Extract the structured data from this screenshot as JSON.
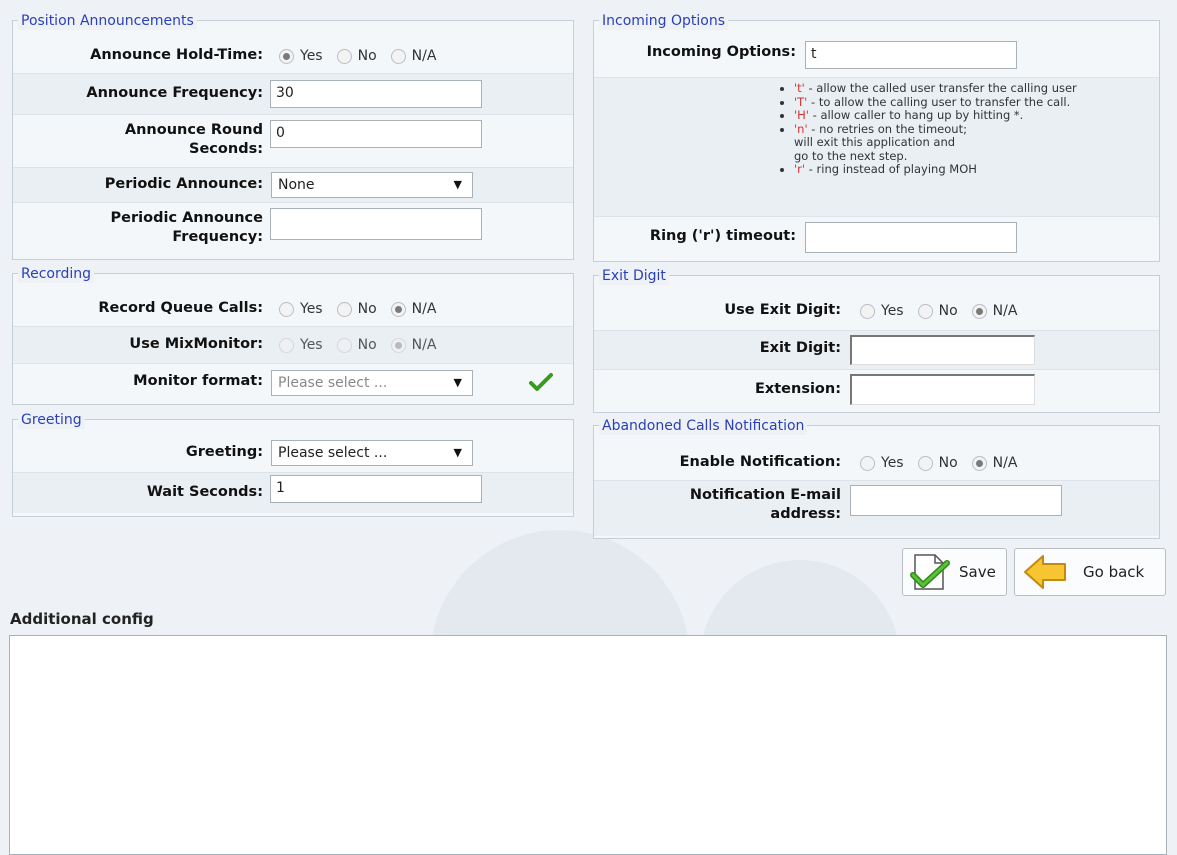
{
  "position_announcements": {
    "title": "Position Announcements",
    "announce_hold_time": {
      "label": "Announce Hold-Time:",
      "options": [
        "Yes",
        "No",
        "N/A"
      ],
      "selected": "Yes"
    },
    "announce_frequency": {
      "label": "Announce Frequency:",
      "value": "30"
    },
    "announce_round_seconds": {
      "label_line1": "Announce Round",
      "label_line2": "Seconds:",
      "value": "0"
    },
    "periodic_announce": {
      "label": "Periodic Announce:",
      "value": "None"
    },
    "periodic_announce_frequency": {
      "label_line1": "Periodic Announce",
      "label_line2": "Frequency:",
      "value": ""
    }
  },
  "recording": {
    "title": "Recording",
    "record_queue_calls": {
      "label": "Record Queue Calls:",
      "options": [
        "Yes",
        "No",
        "N/A"
      ],
      "selected": "N/A"
    },
    "use_mixmonitor": {
      "label": "Use MixMonitor:",
      "options": [
        "Yes",
        "No",
        "N/A"
      ],
      "selected": "N/A"
    },
    "monitor_format": {
      "label": "Monitor format:",
      "value": "Please select ..."
    }
  },
  "greeting": {
    "title": "Greeting",
    "greeting": {
      "label": "Greeting:",
      "value": "Please select ..."
    },
    "wait_seconds": {
      "label": "Wait Seconds:",
      "value": "1"
    }
  },
  "incoming_options": {
    "title": "Incoming Options",
    "incoming_options": {
      "label": "Incoming Options:",
      "value": "t"
    },
    "help": [
      {
        "code": "'t'",
        "text": " - allow the called user transfer the calling user"
      },
      {
        "code": "'T'",
        "text": " - to allow the calling user to transfer the call."
      },
      {
        "code": "'H'",
        "text": " - allow caller to hang up by hitting *."
      },
      {
        "code": "'n'",
        "text": " - no retries on the timeout;"
      },
      {
        "code": "",
        "text": "will exit this application and"
      },
      {
        "code": "",
        "text": "go to the next step."
      },
      {
        "code": "'r'",
        "text": " - ring instead of playing MOH"
      }
    ],
    "ring_timeout": {
      "label": "Ring ('r') timeout:",
      "value": ""
    }
  },
  "exit_digit": {
    "title": "Exit Digit",
    "use_exit_digit": {
      "label": "Use Exit Digit:",
      "options": [
        "Yes",
        "No",
        "N/A"
      ],
      "selected": "N/A"
    },
    "exit_digit": {
      "label": "Exit Digit:",
      "value": ""
    },
    "extension": {
      "label": "Extension:",
      "value": ""
    }
  },
  "abandoned_calls": {
    "title": "Abandoned Calls Notification",
    "enable_notification": {
      "label": "Enable Notification:",
      "options": [
        "Yes",
        "No",
        "N/A"
      ],
      "selected": "N/A"
    },
    "notification_email": {
      "label_line1": "Notification E-mail",
      "label_line2": "address:",
      "value": ""
    }
  },
  "buttons": {
    "save": "Save",
    "go_back": "Go back"
  },
  "additional_config": {
    "label": "Additional config",
    "value": ""
  },
  "colors": {
    "legend": "#2a3fb8",
    "help_code": "#d2322d",
    "checkmark": "#3a9a1f"
  }
}
